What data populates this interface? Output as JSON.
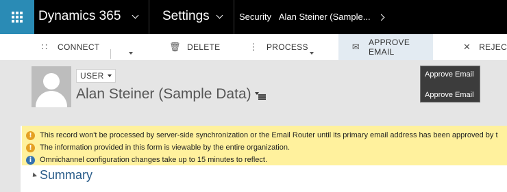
{
  "nav": {
    "app_name": "Dynamics 365",
    "area": "Settings",
    "breadcrumb_section": "Security",
    "breadcrumb_record": "Alan Steiner (Sample..."
  },
  "commands": {
    "connect": "CONNECT",
    "delete": "DELETE",
    "process": "PROCESS",
    "approve_email": "APPROVE EMAIL",
    "reject": "REJECT"
  },
  "record": {
    "type": "USER",
    "name": "Alan Steiner (Sample Data)"
  },
  "tooltip": {
    "title": "Approve Email",
    "description": "Approve Email"
  },
  "notifications": [
    {
      "kind": "warning",
      "text": "This record won't be processed by server-side synchronization or the Email Router until its primary email address has been approved by t"
    },
    {
      "kind": "warning",
      "text": "The information provided in this form is viewable by the entire organization."
    },
    {
      "kind": "info",
      "text": "Omnichannel configuration changes take up to 15 minutes to reflect."
    }
  ],
  "section": {
    "summary": "Summary"
  },
  "colors": {
    "nav_bg": "#000000",
    "waffle_bg": "#2a8bb5",
    "notification_bg": "#fff19d",
    "warning_icon": "#e4a023",
    "info_icon": "#3472b0",
    "link_blue": "#2a5d8a"
  },
  "icons": {
    "waffle": "app-launcher-icon",
    "connect": "connect-icon",
    "delete": "trash-icon",
    "process": "process-icon",
    "approve": "approve-email-icon",
    "reject": "reject-email-icon"
  }
}
